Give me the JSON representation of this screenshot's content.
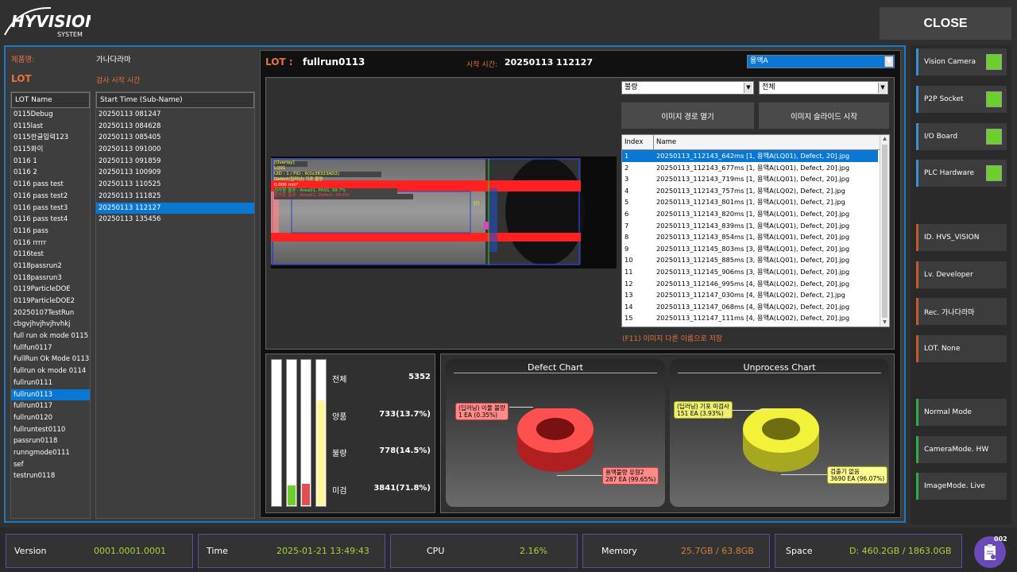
{
  "logo": {
    "main": "HYVISION",
    "sub": "SYSTEM"
  },
  "header": {
    "close_label": "CLOSE"
  },
  "product": {
    "label": "제품명:",
    "value": "가나다라마"
  },
  "lot_section": {
    "label": "LOT",
    "start_time_label": "검사 시작 시간"
  },
  "lot_list": {
    "header": "LOT Name",
    "items": [
      "0115Debug",
      "0115last",
      "0115한글입력123",
      "0115화이",
      "0116 1",
      "0116 2",
      "0116 pass test",
      "0116 pass test2",
      "0116 pass test3",
      "0116 pass test4",
      "0116 pass",
      "0116 rrrrr",
      "0116test",
      "0118passrun2",
      "0118passrun3",
      "0119ParticleDOE",
      "0119ParticleDOE2",
      "20250107TestRun",
      "cbgvjhvjhvjhvhkj",
      "full run ok mode 0115",
      "fullfun0117",
      "FullRun Ok Mode 0113",
      "fullrun ok mode 0114",
      "fullrun0111",
      "fullrun0113",
      "fullrun0117",
      "fullrun0120",
      "fullruntest0110",
      "passrun0118",
      "runngmode0111",
      "sef",
      "testrun0118"
    ],
    "selected_index": 24
  },
  "start_list": {
    "header": "Start Time (Sub-Name)",
    "items": [
      "20250113 081247",
      "20250113 084628",
      "20250113 085405",
      "20250113 091000",
      "20250113 091859",
      "20250113 100909",
      "20250113 110525",
      "20250113 111825",
      "20250113 112127",
      "20250113 135456"
    ],
    "selected_index": 8
  },
  "viewer": {
    "lot_label": "LOT :",
    "lot_value": "fullrun0113",
    "start_label": "시작 시간:",
    "start_value": "20250113 112127",
    "solution_select": "용액A",
    "filter_select": "불량",
    "filter2_select": "전체",
    "open_path_btn": "이미지 경로 열기",
    "slideshow_btn": "이미지 슬라이드 시작",
    "save_as_hint": "(F11) 이미지 다른 이름으로 저장",
    "overlay": [
      "[Overlay]",
      "LQ01",
      "UID : 1 / FID : 6(0x38323AD2)",
      "Defect(딥러닝) 기포 불량",
      "0.000 mm²",
      "검사항 결과 : Area01, PASS, 99.7%",
      "불량항 결과 : Area01, Defect, 99.6%"
    ],
    "cursor_marker": "(!)"
  },
  "file_table": {
    "headers": [
      "Index",
      "Name"
    ],
    "rows": [
      [
        "1",
        "20250113_112143_642ms [1, 용액A(LQ01), Defect, 20].jpg"
      ],
      [
        "2",
        "20250113_112143_677ms [1, 용액A(LQ01), Defect, 20].jpg"
      ],
      [
        "3",
        "20250113_112143_719ms [1, 용액A(LQ01), Defect, 20].jpg"
      ],
      [
        "4",
        "20250113_112143_757ms [1, 용액A(LQ02), Defect, 2].jpg"
      ],
      [
        "5",
        "20250113_112143_801ms [1, 용액A(LQ01), Defect, 2].jpg"
      ],
      [
        "6",
        "20250113_112143_820ms [1, 용액A(LQ01), Defect, 20].jpg"
      ],
      [
        "7",
        "20250113_112143_839ms [1, 용액A(LQ01), Defect, 20].jpg"
      ],
      [
        "8",
        "20250113_112143_854ms [1, 용액A(LQ01), Defect, 20].jpg"
      ],
      [
        "9",
        "20250113_112145_803ms [3, 용액A(LQ01), Defect, 20].jpg"
      ],
      [
        "10",
        "20250113_112145_885ms [3, 용액A(LQ01), Defect, 20].jpg"
      ],
      [
        "11",
        "20250113_112145_906ms [3, 용액A(LQ01), Defect, 20].jpg"
      ],
      [
        "12",
        "20250113_112146_995ms [4, 용액A(LQ02), Defect, 20].jpg"
      ],
      [
        "13",
        "20250113_112147_030ms [4, 용액A(LQ02), Defect, 2].jpg"
      ],
      [
        "14",
        "20250113_112147_068ms [4, 용액A(LQ02), Defect, 20].jpg"
      ],
      [
        "15",
        "20250113_112147_111ms [4, 용액A(LQ02), Defect, 20].jpg"
      ]
    ],
    "selected_index": 0
  },
  "stats": {
    "total_label": "전체",
    "total_value": "5352",
    "good_label": "양품",
    "good_value": "733(13.7%)",
    "bad_label": "불량",
    "bad_value": "778(14.5%)",
    "unprocessed_label": "미검",
    "unprocessed_value": "3841(71.8%)",
    "bars": [
      {
        "level": 0.0,
        "color": "#ffffff"
      },
      {
        "level": 0.137,
        "color": "#6ccf2e"
      },
      {
        "level": 0.145,
        "color": "#e05050"
      },
      {
        "level": 0.718,
        "color": "#fff59a"
      }
    ]
  },
  "defect_chart": {
    "title": "Defect Chart",
    "callout1_line1": "(딥러닝) 이물 불량",
    "callout1_line2": "1 EA (0.35%)",
    "callout2_line1": "용액불량 유형2",
    "callout2_line2": "287 EA (99.65%)",
    "color": "#ff4a4a"
  },
  "unprocess_chart": {
    "title": "Unprocess Chart",
    "callout1_line1": "(딥러닝) 기포 미검사",
    "callout1_line2": "151 EA (3.93%)",
    "callout2_line1": "검출기 없음",
    "callout2_line2": "3690 EA (96.07%)",
    "color": "#f2f23a"
  },
  "sidebar": {
    "devices": [
      {
        "label": "Vision Camera",
        "status_color": "#6ccf2e"
      },
      {
        "label": "P2P Socket",
        "status_color": "#6ccf2e"
      },
      {
        "label": "I/O Board",
        "status_color": "#6ccf2e"
      },
      {
        "label": "PLC Hardware",
        "status_color": "#6ccf2e"
      }
    ],
    "user_info": [
      "ID. HVS_VISION",
      "Lv. Developer",
      "Rec. 가나다라마",
      "LOT. None"
    ],
    "modes": [
      "Normal Mode",
      "CameraMode. HW",
      "ImageMode. Live"
    ]
  },
  "status_bar": {
    "version_label": "Version",
    "version_value": "0001.0001.0001",
    "time_label": "Time",
    "time_value": "2025-01-21  13:49:43",
    "cpu_label": "CPU",
    "cpu_value": "2.16%",
    "memory_label": "Memory",
    "memory_value": "25.7GB / 63.8GB",
    "space_label": "Space",
    "space_value": "D: 460.2GB / 1863.0GB",
    "badge_count": "002"
  }
}
